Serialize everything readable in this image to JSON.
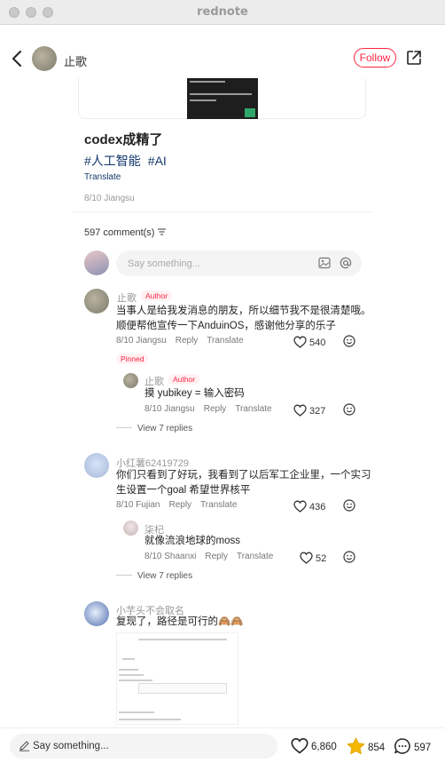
{
  "window": {
    "title": "rednote"
  },
  "header": {
    "author": "止歌",
    "follow_label": "Follow"
  },
  "post": {
    "title": "codex成精了",
    "tags": [
      "#人工智能",
      "#AI"
    ],
    "translate_label": "Translate",
    "date_location": "8/10 Jiangsu"
  },
  "comments_section": {
    "count_label": "597 comment(s)",
    "input_placeholder": "Say something..."
  },
  "comments": [
    {
      "name": "止歌",
      "badge": "Author",
      "line1": "当事人是给我发消息的朋友，所以细节我不是很清楚哦。",
      "line2": "顺便帮他宣传一下AnduinOS，感谢他分享的乐子",
      "date": "8/10 Jiangsu",
      "reply": "Reply",
      "translate": "Translate",
      "likes": "540",
      "pinned": "Pinned",
      "sub": {
        "name": "止歌",
        "badge": "Author",
        "text": "摸 yubikey = 输入密码",
        "date": "8/10 Jiangsu",
        "reply": "Reply",
        "translate": "Translate",
        "likes": "327"
      },
      "view_replies": "View 7 replies"
    },
    {
      "name": "小红薯62419729",
      "line1": "你们只看到了好玩，我看到了以后军工企业里，一个实习",
      "line2": "生设置一个goal 希望世界核平",
      "date": "8/10 Fujian",
      "reply": "Reply",
      "translate": "Translate",
      "likes": "436",
      "sub": {
        "name": "柒杞",
        "text": "就像流浪地球的moss",
        "date": "8/10 Shaanxi",
        "reply": "Reply",
        "translate": "Translate",
        "likes": "52"
      },
      "view_replies": "View 7 replies"
    },
    {
      "name": "小芋头不会取名",
      "line1": "复现了，路径是可行的",
      "emoji": "🙈🙈"
    }
  ],
  "bottom_bar": {
    "placeholder": "Say something...",
    "likes": "6,860",
    "stars": "854",
    "comments": "597"
  },
  "colors": {
    "accent": "#ff2442",
    "link": "#13386c",
    "star": "#f5b800"
  }
}
